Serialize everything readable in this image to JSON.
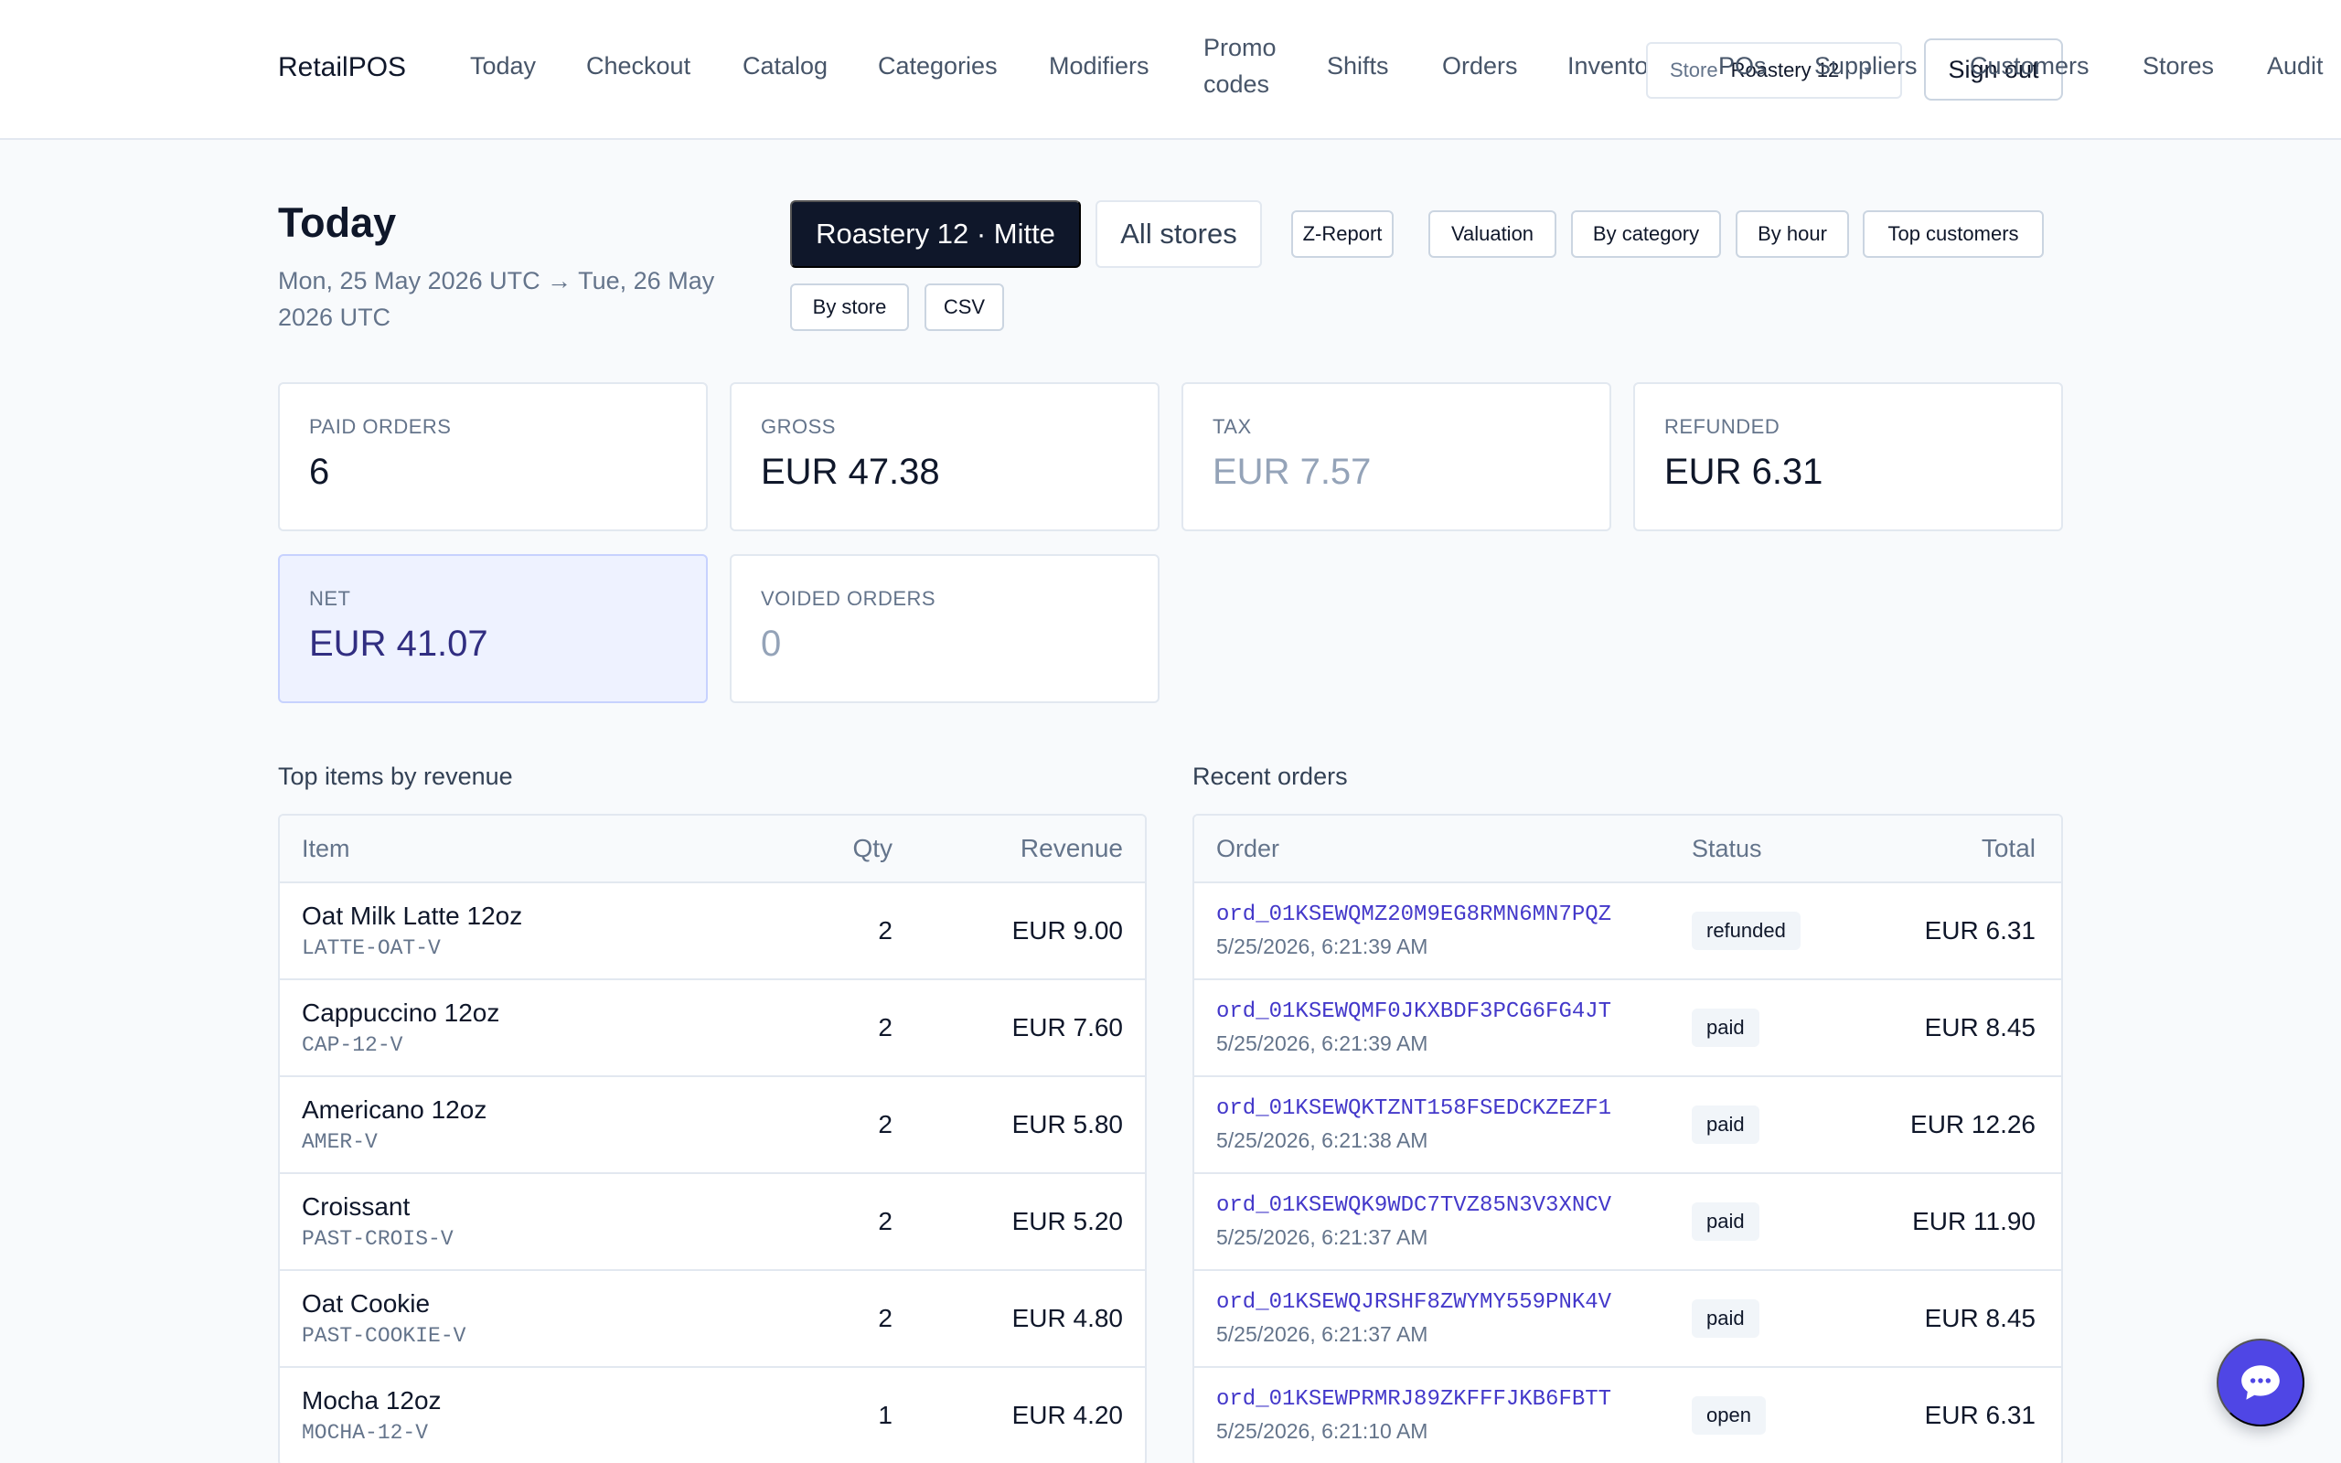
{
  "brand": "RetailPOS",
  "nav": {
    "items": [
      "Today",
      "Checkout",
      "Catalog",
      "Categories",
      "Modifiers",
      "Promo codes",
      "Shifts",
      "Orders",
      "Inventory",
      "POs",
      "Suppliers",
      "Customers",
      "Stores",
      "Audit"
    ]
  },
  "store_selector": {
    "label": "Store",
    "value": "Roastery 12 ·"
  },
  "sign_out": "Sign out",
  "page": {
    "title": "Today",
    "date_range": "Mon, 25 May 2026 UTC → Tue, 26 May 2026 UTC"
  },
  "store_toggle": {
    "active": "Roastery 12 · Mitte",
    "inactive": "All stores"
  },
  "reports": [
    "Z-Report",
    "Valuation",
    "By category",
    "By hour",
    "Top customers",
    "By store",
    "CSV"
  ],
  "kpis": [
    {
      "label": "PAID ORDERS",
      "value": "6"
    },
    {
      "label": "GROSS",
      "value": "EUR 47.38"
    },
    {
      "label": "TAX",
      "value": "EUR 7.57"
    },
    {
      "label": "REFUNDED",
      "value": "EUR 6.31"
    },
    {
      "label": "NET",
      "value": "EUR 41.07"
    },
    {
      "label": "VOIDED ORDERS",
      "value": "0"
    }
  ],
  "top_items": {
    "title": "Top items by revenue",
    "columns": [
      "Item",
      "Qty",
      "Revenue"
    ],
    "rows": [
      {
        "name": "Oat Milk Latte 12oz",
        "sku": "LATTE-OAT-V",
        "qty": "2",
        "revenue": "EUR 9.00"
      },
      {
        "name": "Cappuccino 12oz",
        "sku": "CAP-12-V",
        "qty": "2",
        "revenue": "EUR 7.60"
      },
      {
        "name": "Americano 12oz",
        "sku": "AMER-V",
        "qty": "2",
        "revenue": "EUR 5.80"
      },
      {
        "name": "Croissant",
        "sku": "PAST-CROIS-V",
        "qty": "2",
        "revenue": "EUR 5.20"
      },
      {
        "name": "Oat Cookie",
        "sku": "PAST-COOKIE-V",
        "qty": "2",
        "revenue": "EUR 4.80"
      },
      {
        "name": "Mocha 12oz",
        "sku": "MOCHA-12-V",
        "qty": "1",
        "revenue": "EUR 4.20"
      }
    ]
  },
  "recent_orders": {
    "title": "Recent orders",
    "columns": [
      "Order",
      "Status",
      "Total"
    ],
    "rows": [
      {
        "id": "ord_01KSEWQMZ20M9EG8RMN6MN7PQZ",
        "time": "5/25/2026, 6:21:39 AM",
        "status": "refunded",
        "total": "EUR 6.31"
      },
      {
        "id": "ord_01KSEWQMF0JKXBDF3PCG6FG4JT",
        "time": "5/25/2026, 6:21:39 AM",
        "status": "paid",
        "total": "EUR 8.45"
      },
      {
        "id": "ord_01KSEWQKTZNT158FSEDCKZEZF1",
        "time": "5/25/2026, 6:21:38 AM",
        "status": "paid",
        "total": "EUR 12.26"
      },
      {
        "id": "ord_01KSEWQK9WDC7TVZ85N3V3XNCV",
        "time": "5/25/2026, 6:21:37 AM",
        "status": "paid",
        "total": "EUR 11.90"
      },
      {
        "id": "ord_01KSEWQJRSHF8ZWYMY559PNK4V",
        "time": "5/25/2026, 6:21:37 AM",
        "status": "paid",
        "total": "EUR 8.45"
      },
      {
        "id": "ord_01KSEWPRMRJ89ZKFFFJKB6FBTT",
        "time": "5/25/2026, 6:21:10 AM",
        "status": "open",
        "total": "EUR 6.31"
      }
    ]
  },
  "colors": {
    "accent": "#4f46e5",
    "link": "#4338ca",
    "primary_dark": "#0f172a",
    "net_highlight": "#eef2ff"
  },
  "chat_fab": {
    "icon": "chat-bubble-icon"
  }
}
